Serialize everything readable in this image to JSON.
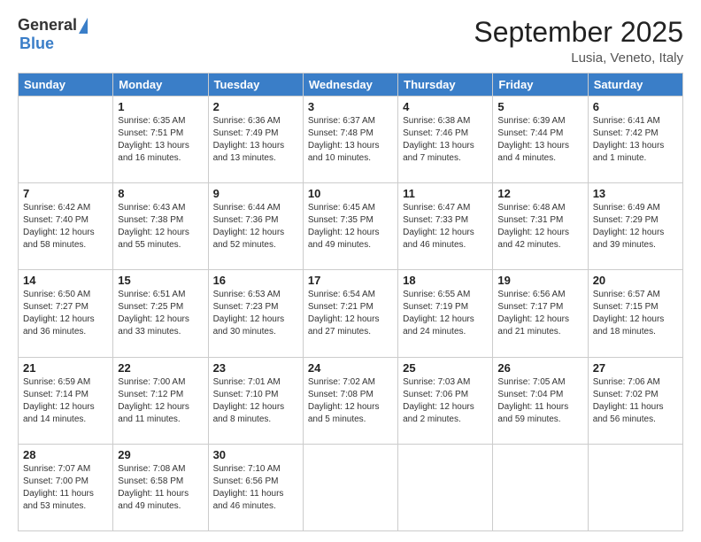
{
  "logo": {
    "general": "General",
    "blue": "Blue"
  },
  "title": "September 2025",
  "subtitle": "Lusia, Veneto, Italy",
  "weekdays": [
    "Sunday",
    "Monday",
    "Tuesday",
    "Wednesday",
    "Thursday",
    "Friday",
    "Saturday"
  ],
  "weeks": [
    [
      {
        "day": null,
        "sunrise": null,
        "sunset": null,
        "daylight": null
      },
      {
        "day": "1",
        "sunrise": "Sunrise: 6:35 AM",
        "sunset": "Sunset: 7:51 PM",
        "daylight": "Daylight: 13 hours and 16 minutes."
      },
      {
        "day": "2",
        "sunrise": "Sunrise: 6:36 AM",
        "sunset": "Sunset: 7:49 PM",
        "daylight": "Daylight: 13 hours and 13 minutes."
      },
      {
        "day": "3",
        "sunrise": "Sunrise: 6:37 AM",
        "sunset": "Sunset: 7:48 PM",
        "daylight": "Daylight: 13 hours and 10 minutes."
      },
      {
        "day": "4",
        "sunrise": "Sunrise: 6:38 AM",
        "sunset": "Sunset: 7:46 PM",
        "daylight": "Daylight: 13 hours and 7 minutes."
      },
      {
        "day": "5",
        "sunrise": "Sunrise: 6:39 AM",
        "sunset": "Sunset: 7:44 PM",
        "daylight": "Daylight: 13 hours and 4 minutes."
      },
      {
        "day": "6",
        "sunrise": "Sunrise: 6:41 AM",
        "sunset": "Sunset: 7:42 PM",
        "daylight": "Daylight: 13 hours and 1 minute."
      }
    ],
    [
      {
        "day": "7",
        "sunrise": "Sunrise: 6:42 AM",
        "sunset": "Sunset: 7:40 PM",
        "daylight": "Daylight: 12 hours and 58 minutes."
      },
      {
        "day": "8",
        "sunrise": "Sunrise: 6:43 AM",
        "sunset": "Sunset: 7:38 PM",
        "daylight": "Daylight: 12 hours and 55 minutes."
      },
      {
        "day": "9",
        "sunrise": "Sunrise: 6:44 AM",
        "sunset": "Sunset: 7:36 PM",
        "daylight": "Daylight: 12 hours and 52 minutes."
      },
      {
        "day": "10",
        "sunrise": "Sunrise: 6:45 AM",
        "sunset": "Sunset: 7:35 PM",
        "daylight": "Daylight: 12 hours and 49 minutes."
      },
      {
        "day": "11",
        "sunrise": "Sunrise: 6:47 AM",
        "sunset": "Sunset: 7:33 PM",
        "daylight": "Daylight: 12 hours and 46 minutes."
      },
      {
        "day": "12",
        "sunrise": "Sunrise: 6:48 AM",
        "sunset": "Sunset: 7:31 PM",
        "daylight": "Daylight: 12 hours and 42 minutes."
      },
      {
        "day": "13",
        "sunrise": "Sunrise: 6:49 AM",
        "sunset": "Sunset: 7:29 PM",
        "daylight": "Daylight: 12 hours and 39 minutes."
      }
    ],
    [
      {
        "day": "14",
        "sunrise": "Sunrise: 6:50 AM",
        "sunset": "Sunset: 7:27 PM",
        "daylight": "Daylight: 12 hours and 36 minutes."
      },
      {
        "day": "15",
        "sunrise": "Sunrise: 6:51 AM",
        "sunset": "Sunset: 7:25 PM",
        "daylight": "Daylight: 12 hours and 33 minutes."
      },
      {
        "day": "16",
        "sunrise": "Sunrise: 6:53 AM",
        "sunset": "Sunset: 7:23 PM",
        "daylight": "Daylight: 12 hours and 30 minutes."
      },
      {
        "day": "17",
        "sunrise": "Sunrise: 6:54 AM",
        "sunset": "Sunset: 7:21 PM",
        "daylight": "Daylight: 12 hours and 27 minutes."
      },
      {
        "day": "18",
        "sunrise": "Sunrise: 6:55 AM",
        "sunset": "Sunset: 7:19 PM",
        "daylight": "Daylight: 12 hours and 24 minutes."
      },
      {
        "day": "19",
        "sunrise": "Sunrise: 6:56 AM",
        "sunset": "Sunset: 7:17 PM",
        "daylight": "Daylight: 12 hours and 21 minutes."
      },
      {
        "day": "20",
        "sunrise": "Sunrise: 6:57 AM",
        "sunset": "Sunset: 7:15 PM",
        "daylight": "Daylight: 12 hours and 18 minutes."
      }
    ],
    [
      {
        "day": "21",
        "sunrise": "Sunrise: 6:59 AM",
        "sunset": "Sunset: 7:14 PM",
        "daylight": "Daylight: 12 hours and 14 minutes."
      },
      {
        "day": "22",
        "sunrise": "Sunrise: 7:00 AM",
        "sunset": "Sunset: 7:12 PM",
        "daylight": "Daylight: 12 hours and 11 minutes."
      },
      {
        "day": "23",
        "sunrise": "Sunrise: 7:01 AM",
        "sunset": "Sunset: 7:10 PM",
        "daylight": "Daylight: 12 hours and 8 minutes."
      },
      {
        "day": "24",
        "sunrise": "Sunrise: 7:02 AM",
        "sunset": "Sunset: 7:08 PM",
        "daylight": "Daylight: 12 hours and 5 minutes."
      },
      {
        "day": "25",
        "sunrise": "Sunrise: 7:03 AM",
        "sunset": "Sunset: 7:06 PM",
        "daylight": "Daylight: 12 hours and 2 minutes."
      },
      {
        "day": "26",
        "sunrise": "Sunrise: 7:05 AM",
        "sunset": "Sunset: 7:04 PM",
        "daylight": "Daylight: 11 hours and 59 minutes."
      },
      {
        "day": "27",
        "sunrise": "Sunrise: 7:06 AM",
        "sunset": "Sunset: 7:02 PM",
        "daylight": "Daylight: 11 hours and 56 minutes."
      }
    ],
    [
      {
        "day": "28",
        "sunrise": "Sunrise: 7:07 AM",
        "sunset": "Sunset: 7:00 PM",
        "daylight": "Daylight: 11 hours and 53 minutes."
      },
      {
        "day": "29",
        "sunrise": "Sunrise: 7:08 AM",
        "sunset": "Sunset: 6:58 PM",
        "daylight": "Daylight: 11 hours and 49 minutes."
      },
      {
        "day": "30",
        "sunrise": "Sunrise: 7:10 AM",
        "sunset": "Sunset: 6:56 PM",
        "daylight": "Daylight: 11 hours and 46 minutes."
      },
      {
        "day": null,
        "sunrise": null,
        "sunset": null,
        "daylight": null
      },
      {
        "day": null,
        "sunrise": null,
        "sunset": null,
        "daylight": null
      },
      {
        "day": null,
        "sunrise": null,
        "sunset": null,
        "daylight": null
      },
      {
        "day": null,
        "sunrise": null,
        "sunset": null,
        "daylight": null
      }
    ]
  ]
}
